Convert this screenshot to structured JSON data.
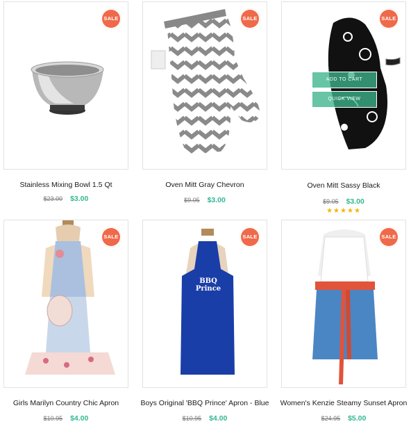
{
  "sale_label": "SALE",
  "colors": {
    "accent": "#33b891",
    "sale": "#ef6a4a",
    "rating": "#f5b400"
  },
  "products": [
    {
      "title": "Stainless Mixing Bowl 1.5 Qt",
      "old_price": "$23.00",
      "price": "$3.00"
    },
    {
      "title": "Oven Mitt Gray Chevron",
      "old_price": "$9.05",
      "price": "$3.00"
    },
    {
      "title": "Oven Mitt Sassy Black",
      "old_price": "$9.05",
      "price": "$3.00",
      "rating": 5,
      "rating_stars": "★★★★★",
      "actions": {
        "add_to_cart": "ADD TO CART",
        "quick_view": "QUICK VIEW"
      }
    },
    {
      "title": "Girls Marilyn Country Chic Apron",
      "old_price": "$10.95",
      "price": "$4.00"
    },
    {
      "title": "Boys Original 'BBQ Prince' Apron - Blue",
      "old_price": "$10.95",
      "price": "$4.00",
      "apron_text": "BBQ Prince"
    },
    {
      "title": "Women's Kenzie Steamy Sunset Apron",
      "old_price": "$24.95",
      "price": "$5.00"
    }
  ]
}
